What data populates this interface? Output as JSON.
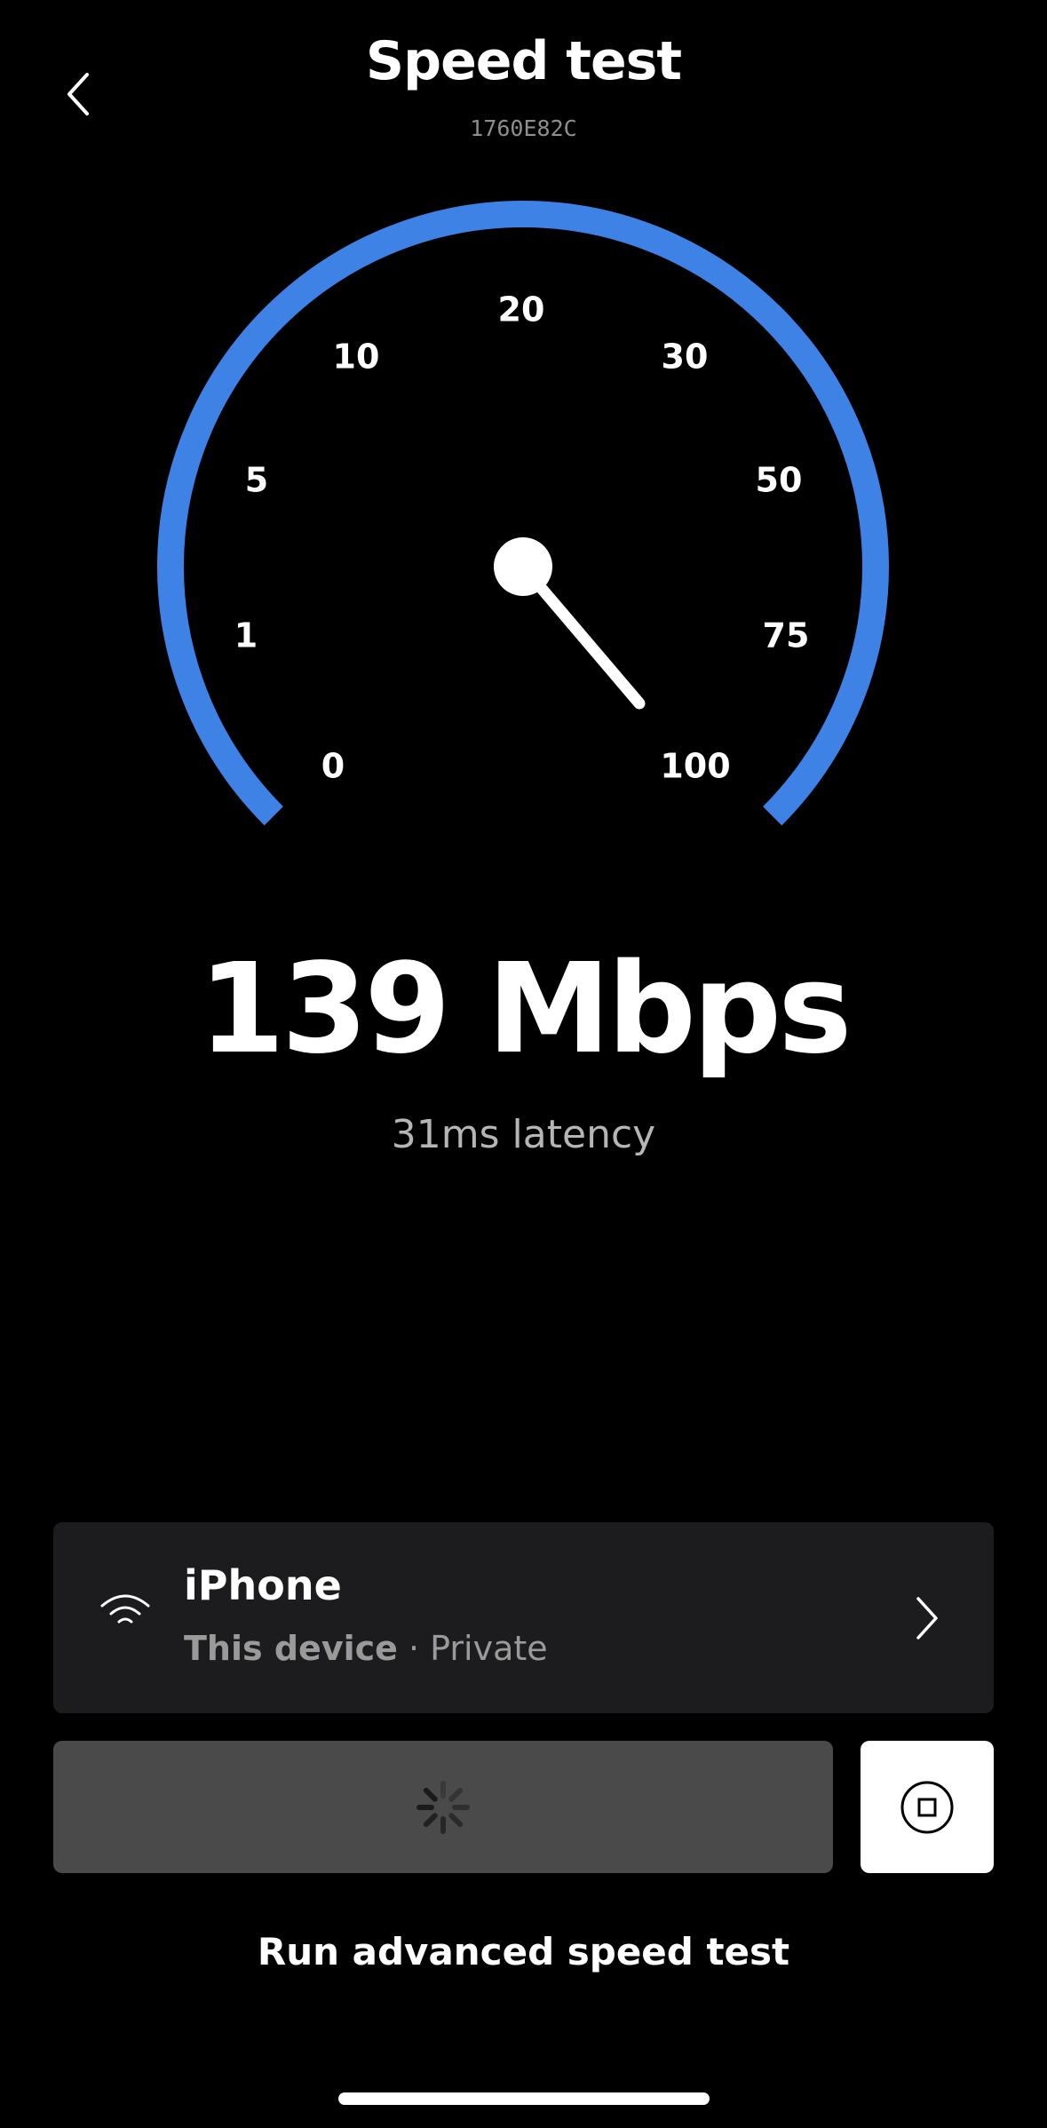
{
  "header": {
    "title": "Speed test",
    "device_id": "1760E82C",
    "back_icon": "chevron-left-icon"
  },
  "gauge": {
    "accent_color": "#3E82E6",
    "ticks": [
      {
        "label": "0"
      },
      {
        "label": "1"
      },
      {
        "label": "5"
      },
      {
        "label": "10"
      },
      {
        "label": "20"
      },
      {
        "label": "30"
      },
      {
        "label": "50"
      },
      {
        "label": "75"
      },
      {
        "label": "100"
      }
    ],
    "needle_value": 139
  },
  "result": {
    "speed": "139 Mbps",
    "latency": "31ms latency"
  },
  "device": {
    "icon": "wifi-icon",
    "name": "iPhone",
    "sub_bold": "This device",
    "sub_rest": " · Private",
    "chevron_icon": "chevron-right-icon"
  },
  "actions": {
    "start_icon": "spinner-icon",
    "stop_icon": "stop-icon",
    "advanced_label": "Run advanced speed test"
  }
}
